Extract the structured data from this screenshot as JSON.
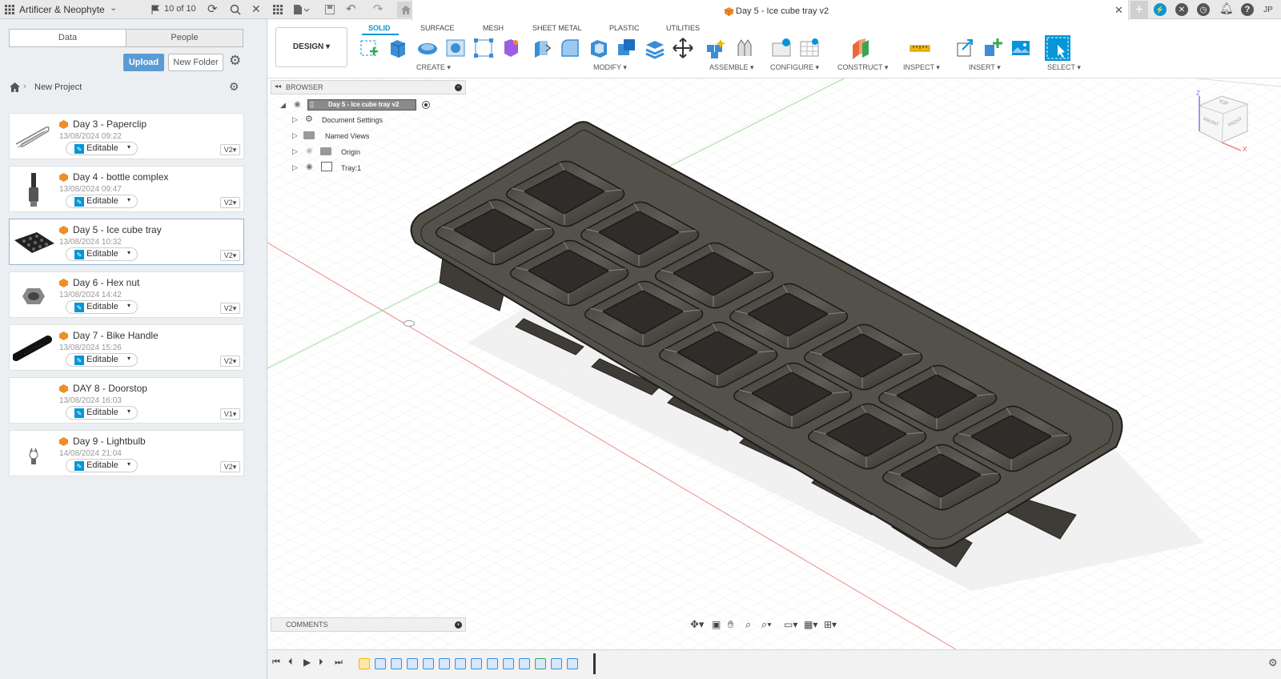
{
  "app": {
    "team": "Artificer & Neophyte",
    "jobs": "10 of 10",
    "user_initials": "JP"
  },
  "doc_tab": {
    "title": "Day 5 - Ice cube tray v2"
  },
  "panel": {
    "tabs": [
      "Data",
      "People"
    ],
    "upload": "Upload",
    "new_folder": "New Folder",
    "breadcrumb": "New Project",
    "files": [
      {
        "name": "Day 3 - Paperclip",
        "date": "13/08/2024 09:22",
        "status": "Editable",
        "version": "V2"
      },
      {
        "name": "Day 4 - bottle complex",
        "date": "13/08/2024 09:47",
        "status": "Editable",
        "version": "V2"
      },
      {
        "name": "Day 5 - Ice cube tray",
        "date": "13/08/2024 10:32",
        "status": "Editable",
        "version": "V2"
      },
      {
        "name": "Day 6 - Hex nut",
        "date": "13/08/2024 14:42",
        "status": "Editable",
        "version": "V2"
      },
      {
        "name": "Day 7 - Bike Handle",
        "date": "13/08/2024 15:26",
        "status": "Editable",
        "version": "V2"
      },
      {
        "name": "DAY 8 - Doorstop",
        "date": "13/08/2024 16:03",
        "status": "Editable",
        "version": "V1"
      },
      {
        "name": "Day 9 - Lightbulb",
        "date": "14/08/2024 21:04",
        "status": "Editable",
        "version": "V2"
      }
    ]
  },
  "toolbar": {
    "workspace": "DESIGN",
    "tabs": [
      "SOLID",
      "SURFACE",
      "MESH",
      "SHEET METAL",
      "PLASTIC",
      "UTILITIES"
    ],
    "groups": [
      "CREATE",
      "MODIFY",
      "ASSEMBLE",
      "CONFIGURE",
      "CONSTRUCT",
      "INSPECT",
      "INSERT",
      "SELECT"
    ]
  },
  "browser": {
    "title": "BROWSER",
    "root": "Day 5 - Ice cube tray v2",
    "items": [
      "Document Settings",
      "Named Views",
      "Origin",
      "Tray:1"
    ]
  },
  "viewcube": {
    "top": "TOP",
    "front": "FRONT",
    "right": "RIGHT",
    "z": "Z",
    "x": "X"
  },
  "comments": {
    "label": "COMMENTS"
  },
  "colors": {
    "accent": "#0696d7",
    "upload": "#5b9bd5",
    "tray": "#4d4a44",
    "orange": "#f28c28"
  }
}
